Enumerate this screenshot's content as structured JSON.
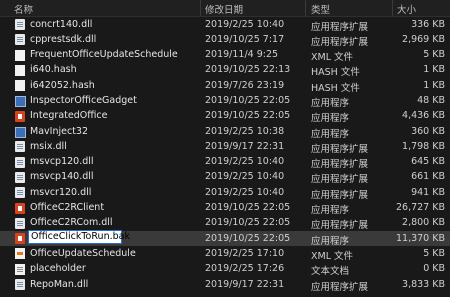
{
  "columns": {
    "name": "名称",
    "date": "修改日期",
    "type": "类型",
    "size": "大小"
  },
  "files": [
    {
      "name": "concrt140.dll",
      "date": "2019/2/25 10:40",
      "type": "应用程序扩展",
      "size": "336 KB",
      "icon": "dll-file-icon"
    },
    {
      "name": "cpprestsdk.dll",
      "date": "2019/10/25 7:17",
      "type": "应用程序扩展",
      "size": "2,969 KB",
      "icon": "dll-file-icon"
    },
    {
      "name": "FrequentOfficeUpdateSchedule",
      "date": "2019/11/4 9:25",
      "type": "XML 文件",
      "size": "5 KB",
      "icon": "generic-file-icon"
    },
    {
      "name": "i640.hash",
      "date": "2019/10/25 22:13",
      "type": "HASH 文件",
      "size": "1 KB",
      "icon": "generic-file-icon"
    },
    {
      "name": "i642052.hash",
      "date": "2019/7/26 23:19",
      "type": "HASH 文件",
      "size": "1 KB",
      "icon": "generic-file-icon"
    },
    {
      "name": "InspectorOfficeGadget",
      "date": "2019/10/25 22:05",
      "type": "应用程序",
      "size": "48 KB",
      "icon": "exe-file-icon"
    },
    {
      "name": "IntegratedOffice",
      "date": "2019/10/25 22:05",
      "type": "应用程序",
      "size": "4,436 KB",
      "icon": "office-app-icon"
    },
    {
      "name": "MavInject32",
      "date": "2019/2/25 10:38",
      "type": "应用程序",
      "size": "360 KB",
      "icon": "exe-file-icon"
    },
    {
      "name": "msix.dll",
      "date": "2019/9/17 22:31",
      "type": "应用程序扩展",
      "size": "1,798 KB",
      "icon": "dll-file-icon"
    },
    {
      "name": "msvcp120.dll",
      "date": "2019/2/25 10:40",
      "type": "应用程序扩展",
      "size": "645 KB",
      "icon": "dll-file-icon"
    },
    {
      "name": "msvcp140.dll",
      "date": "2019/2/25 10:40",
      "type": "应用程序扩展",
      "size": "661 KB",
      "icon": "dll-file-icon"
    },
    {
      "name": "msvcr120.dll",
      "date": "2019/2/25 10:40",
      "type": "应用程序扩展",
      "size": "941 KB",
      "icon": "dll-file-icon"
    },
    {
      "name": "OfficeC2RClient",
      "date": "2019/10/25 22:05",
      "type": "应用程序",
      "size": "26,727 KB",
      "icon": "office-app-icon"
    },
    {
      "name": "OfficeC2RCom.dll",
      "date": "2019/10/25 22:05",
      "type": "应用程序扩展",
      "size": "2,800 KB",
      "icon": "dll-file-icon"
    },
    {
      "name": "OfficeClickToRun.bak",
      "date": "2019/10/25 22:05",
      "type": "应用程序",
      "size": "11,370 KB",
      "icon": "office-app-icon",
      "selected": true,
      "editing": true
    },
    {
      "name": "OfficeUpdateSchedule",
      "date": "2019/2/25 17:10",
      "type": "XML 文件",
      "size": "5 KB",
      "icon": "xml-file-icon"
    },
    {
      "name": "placeholder",
      "date": "2019/2/25 17:26",
      "type": "文本文档",
      "size": "0 KB",
      "icon": "text-file-icon"
    },
    {
      "name": "RepoMan.dll",
      "date": "2019/9/17 22:31",
      "type": "应用程序扩展",
      "size": "3,833 KB",
      "icon": "dll-file-icon"
    }
  ]
}
